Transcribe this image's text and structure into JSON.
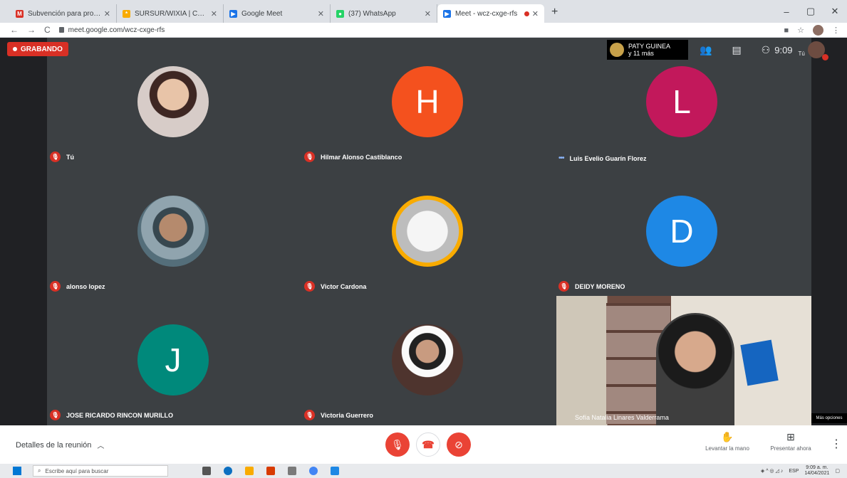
{
  "browser": {
    "tabs": [
      {
        "label": "Subvención para programa Uniti...",
        "fav_color": "#d93025",
        "fav_glyph": "M"
      },
      {
        "label": "SURSUR/WIXIA | Comunidad S...",
        "fav_color": "#f9ab00",
        "fav_glyph": "*"
      },
      {
        "label": "Google Meet",
        "fav_color": "#1a73e8",
        "fav_glyph": "▶"
      },
      {
        "label": "(37) WhatsApp",
        "fav_color": "#25d366",
        "fav_glyph": "●"
      },
      {
        "label": "Meet - wcz-cxge-rfs",
        "fav_color": "#1a73e8",
        "fav_glyph": "▶",
        "active": true,
        "recording": true
      }
    ],
    "new_tab": "+",
    "window_controls": [
      "–",
      "▢",
      "✕"
    ],
    "url": "meet.google.com/wcz-cxge-rfs",
    "nav": [
      "←",
      "→",
      "C"
    ]
  },
  "meet": {
    "recording_label": "GRABANDO",
    "presenter": {
      "name": "PATY GUINEA",
      "more": "y 11 más"
    },
    "clock": "9:09",
    "self_label": "Tú",
    "participants": [
      {
        "name": "Tú",
        "kind": "photo",
        "muted": true
      },
      {
        "name": "Hilmar Alonso Castiblanco",
        "kind": "letter",
        "letter": "H",
        "color": "#f4511e",
        "muted": true
      },
      {
        "name": "Luis Evelio Guarín Florez",
        "kind": "letter",
        "letter": "L",
        "color": "#c2185b",
        "muted": false
      },
      {
        "name": "alonso lopez",
        "kind": "photo",
        "muted": true
      },
      {
        "name": "Victor Cardona",
        "kind": "photo",
        "muted": true
      },
      {
        "name": "DEIDY MORENO",
        "kind": "letter",
        "letter": "D",
        "color": "#1e88e5",
        "muted": true
      },
      {
        "name": "JOSE RICARDO RINCON MURILLO",
        "kind": "letter",
        "letter": "J",
        "color": "#00897b",
        "muted": true
      },
      {
        "name": "Victoria Guerrero",
        "kind": "photo",
        "muted": true
      }
    ],
    "video_participant": {
      "name": "Sofía Natalia Linares Valderrama"
    },
    "more_options": "Más opciones"
  },
  "controls": {
    "details_label": "Detalles de la reunión",
    "raise_hand": "Levantar la mano",
    "present_now": "Presentar ahora"
  },
  "taskbar": {
    "search_placeholder": "Escribe aquí para buscar",
    "lang": "ESP",
    "time": "9:09 a. m.",
    "date": "14/04/2021"
  }
}
